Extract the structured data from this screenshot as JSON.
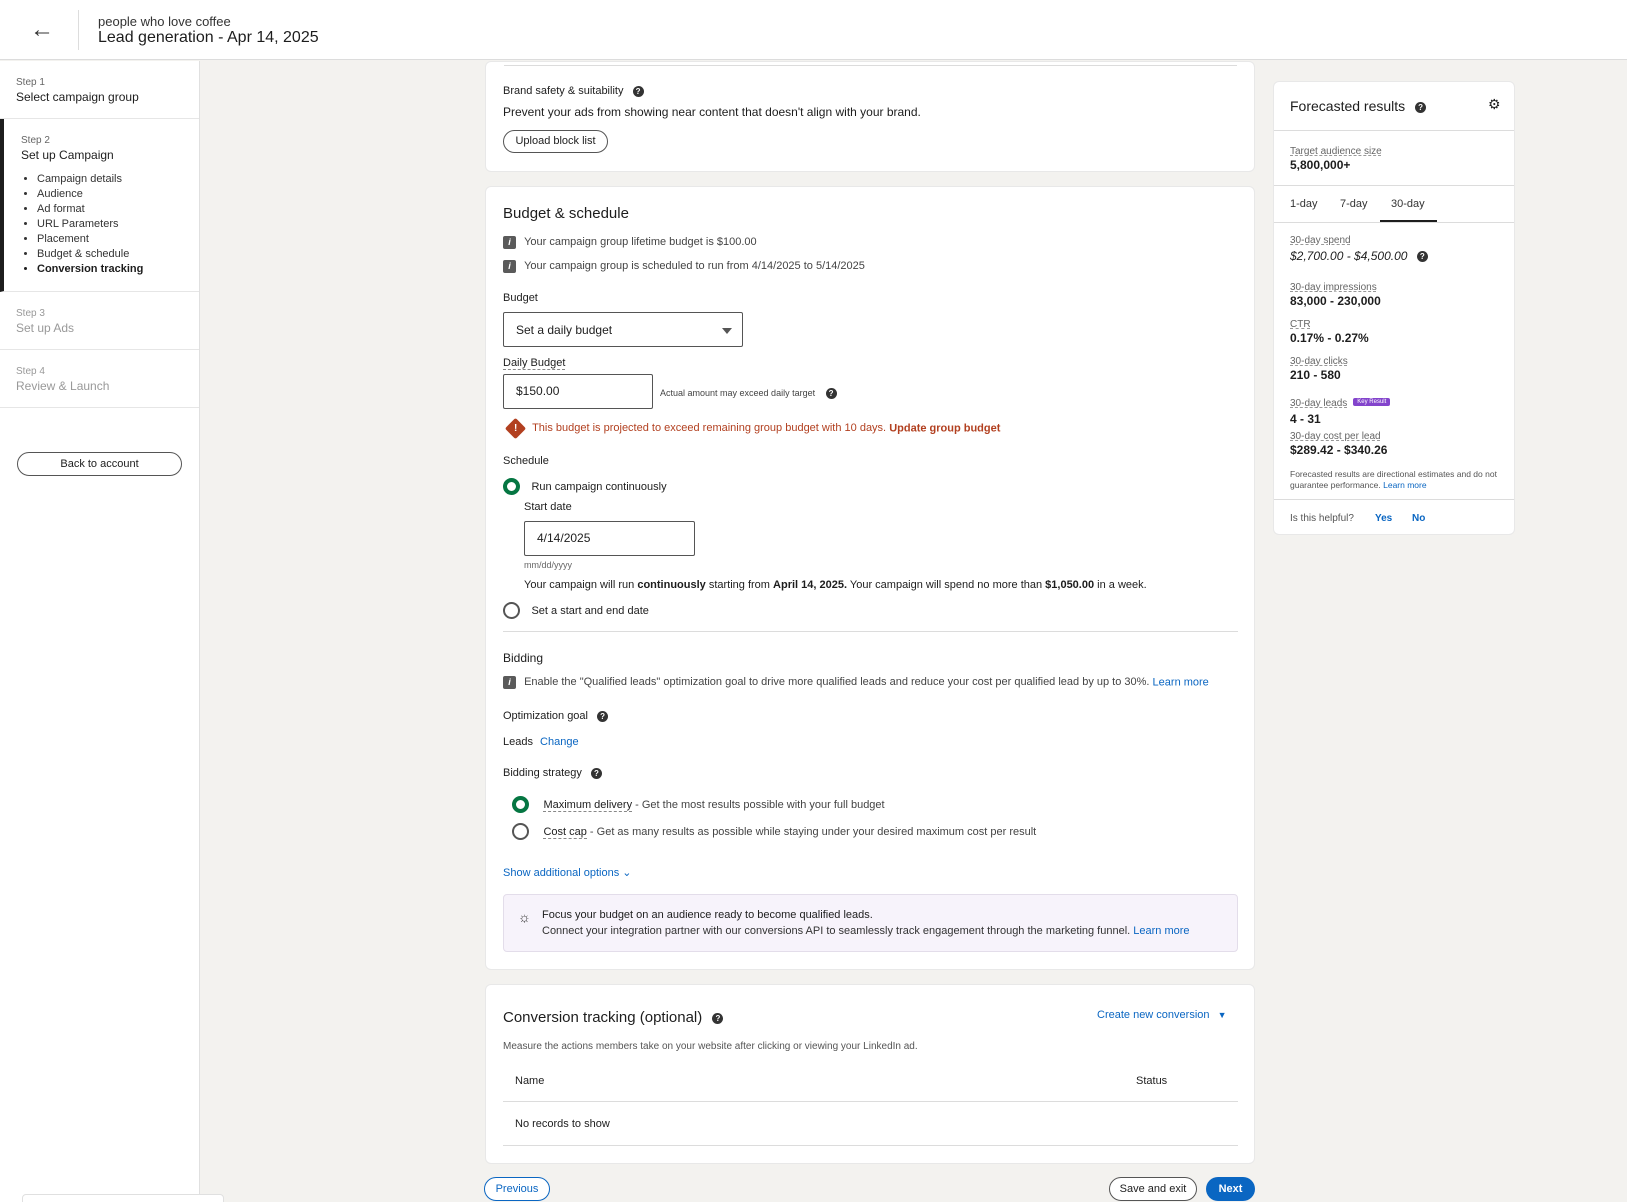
{
  "header": {
    "subtitle": "people who love coffee",
    "title": "Lead generation - Apr 14, 2025"
  },
  "sidebar": {
    "steps": [
      {
        "num": "Step 1",
        "title": "Select campaign group"
      },
      {
        "num": "Step 2",
        "title": "Set up Campaign",
        "items": [
          "Campaign details",
          "Audience",
          "Ad format",
          "URL Parameters",
          "Placement",
          "Budget & schedule",
          "Conversion tracking"
        ]
      },
      {
        "num": "Step 3",
        "title": "Set up Ads"
      },
      {
        "num": "Step 4",
        "title": "Review & Launch"
      }
    ],
    "back_label": "Back to account"
  },
  "brand_safety": {
    "title": "Brand safety & suitability",
    "desc": "Prevent your ads from showing near content that doesn't align with your brand.",
    "upload_label": "Upload block list"
  },
  "budget_schedule": {
    "title": "Budget & schedule",
    "info1": "Your campaign group lifetime budget is $100.00",
    "info2": "Your campaign group is scheduled to run from 4/14/2025 to 5/14/2025",
    "budget_label": "Budget",
    "budget_select": "Set a daily budget",
    "daily_label": "Daily Budget",
    "daily_value": "$150.00",
    "daily_hint": "Actual amount may exceed daily target",
    "warning": "This budget is projected to exceed remaining group budget with 10 days.",
    "warning_link": "Update group budget",
    "schedule_label": "Schedule",
    "run_continuous": "Run campaign continuously",
    "start_date_label": "Start date",
    "start_date_value": "4/14/2025",
    "date_format": "mm/dd/yyyy",
    "summary_a": "Your campaign will run ",
    "summary_b": "continuously",
    "summary_c": " starting from ",
    "summary_d": "April 14, 2025.",
    "summary_e": " Your campaign will spend no more than ",
    "summary_f": "$1,050.00",
    "summary_g": " in a week.",
    "set_start_end": "Set a start and end date"
  },
  "bidding": {
    "title": "Bidding",
    "info": "Enable the \"Qualified leads\" optimization goal to drive more qualified leads and reduce your cost per qualified lead by up to 30%.",
    "info_link": "Learn more",
    "opt_goal_label": "Optimization goal",
    "opt_goal_value": "Leads",
    "change_label": "Change",
    "strategy_label": "Bidding strategy",
    "max_delivery": "Maximum delivery",
    "max_delivery_desc": " - Get the most results possible with your full budget",
    "cost_cap": "Cost cap",
    "cost_cap_desc": " - Get as many results as possible while staying under your desired maximum cost per result",
    "show_more": "Show additional options",
    "tip_title": "Focus your budget on an audience ready to become qualified leads.",
    "tip_body": "Connect your integration partner with our conversions API to seamlessly track engagement through the marketing funnel.",
    "tip_link": "Learn more"
  },
  "conversion": {
    "title": "Conversion tracking (optional)",
    "create_label": "Create new conversion",
    "desc": "Measure the actions members take on your website after clicking or viewing your LinkedIn ad.",
    "col_name": "Name",
    "col_status": "Status",
    "empty": "No records to show"
  },
  "forecast": {
    "title": "Forecasted results",
    "audience_label": "Target audience size",
    "audience_value": "5,800,000+",
    "tabs": [
      "1-day",
      "7-day",
      "30-day"
    ],
    "active_tab": "30-day",
    "spend_label": "30-day spend",
    "spend_value": "$2,700.00 - $4,500.00",
    "impressions_label": "30-day impressions",
    "impressions_value": "83,000 - 230,000",
    "ctr_label": "CTR",
    "ctr_value": "0.17% - 0.27%",
    "clicks_label": "30-day clicks",
    "clicks_value": "210 - 580",
    "leads_label": "30-day leads",
    "leads_badge": "Key Result",
    "leads_value": "4 - 31",
    "cpl_label": "30-day cost per lead",
    "cpl_value": "$289.42 - $340.26",
    "disclaimer": "Forecasted results are directional estimates and do not guarantee performance.",
    "disclaimer_link": "Learn more",
    "helpful_q": "Is this helpful?",
    "yes": "Yes",
    "no": "No"
  },
  "footer": {
    "previous": "Previous",
    "save_exit": "Save and exit",
    "next": "Next"
  },
  "colors": {
    "accent": "#0a66c2",
    "success": "#057642",
    "warning": "#b24020",
    "badge": "#8344cc"
  }
}
